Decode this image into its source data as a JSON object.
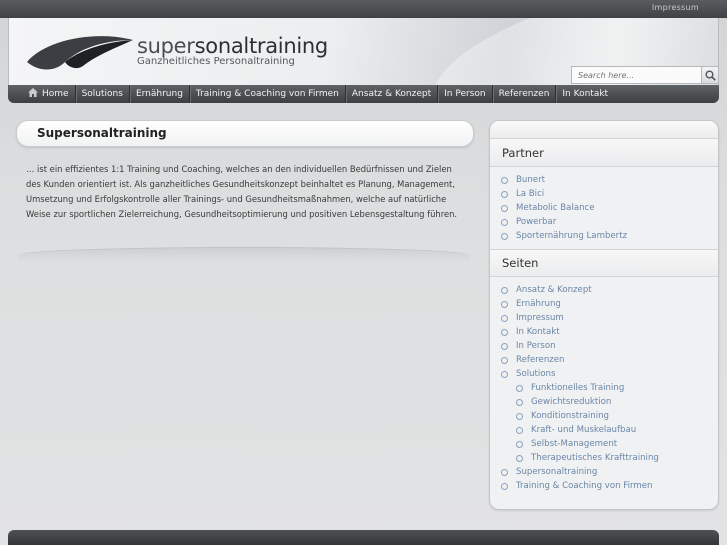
{
  "topbar": {
    "impressum": "Impressum"
  },
  "header": {
    "logo_light": "super",
    "logo_strong": "sonaltraining",
    "logo_sub": "Ganzheitliches Personaltraining"
  },
  "search": {
    "placeholder": "Search here..."
  },
  "nav": {
    "items": [
      "Home",
      "Solutions",
      "Ernährung",
      "Training & Coaching von Firmen",
      "Ansatz & Konzept",
      "In Person",
      "Referenzen",
      "In Kontakt"
    ]
  },
  "main": {
    "title": "Supersonaltraining",
    "text": "… ist ein effizientes 1:1 Training und Coaching, welches an den individuellen Bedürfnissen und Zielen des Kunden orientiert ist. Als ganzheitliches Gesundheitskonzept beinhaltet es Planung, Management, Umsetzung und Erfolgskontrolle aller Trainings- und Gesundheitsmaßnahmen, welche auf natürliche Weise zur sportlichen Zielerreichung, Gesundheitsoptimierung und positiven Lebensgestaltung führen."
  },
  "sidebar": {
    "partner_title": "Partner",
    "partner": [
      "Bunert",
      "La Bici",
      "Metabolic Balance",
      "Powerbar",
      "Sporternährung Lambertz"
    ],
    "seiten_title": "Seiten",
    "seiten": [
      "Ansatz & Konzept",
      "Ernährung",
      "Impressum",
      "In Kontakt",
      "In Person",
      "Referenzen",
      "Solutions"
    ],
    "solutions_sub": [
      "Funktionelles Training",
      "Gewichtsreduktion",
      "Konditionstraining",
      "Kraft- und Muskelaufbau",
      "Selbst-Management",
      "Therapeutisches Krafttraining"
    ],
    "seiten_after": [
      "Supersonaltraining",
      "Training & Coaching von Firmen"
    ]
  },
  "colors": {
    "link": "#6a86a8",
    "nav_bg": "#3c3f42"
  }
}
